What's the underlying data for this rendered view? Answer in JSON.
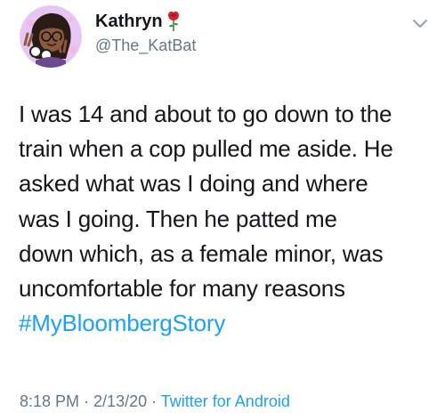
{
  "author": {
    "display_name": "Kathryn",
    "handle": "@The_KatBat",
    "avatar_icon": "cartoon-avatar-icon",
    "emoji_icon": "rose-icon",
    "menu_icon": "chevron-down-icon"
  },
  "tweet": {
    "lines": [
      "I was 14 and about to go down to the",
      "train when a cop pulled me aside. He",
      "asked what was I doing and where",
      "was I going. Then he patted me",
      "down which, as a female minor, was",
      "uncomfortable for many reasons"
    ],
    "hashtag": "#MyBloombergStory"
  },
  "meta": {
    "time": "8:18 PM",
    "separator": " · ",
    "date": "2/13/20",
    "source": "Twitter for Android"
  },
  "colors": {
    "text": "#14171a",
    "secondary": "#657786",
    "link": "#1da1f2"
  }
}
